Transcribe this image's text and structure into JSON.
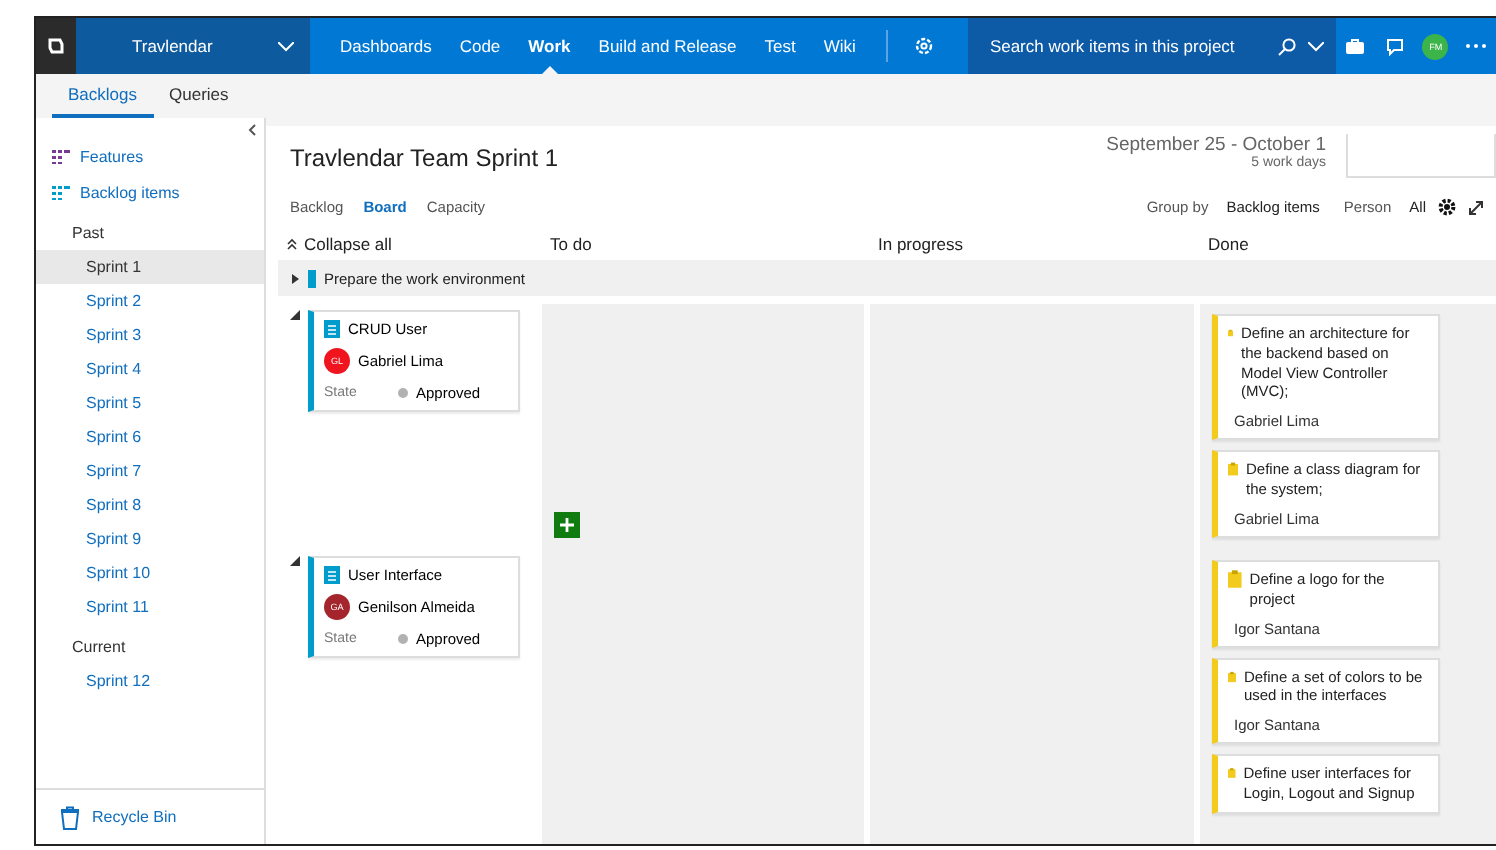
{
  "topbar": {
    "project": "Travlendar",
    "nav": [
      {
        "label": "Dashboards",
        "selected": false
      },
      {
        "label": "Code",
        "selected": false
      },
      {
        "label": "Work",
        "selected": true
      },
      {
        "label": "Build and Release",
        "selected": false
      },
      {
        "label": "Test",
        "selected": false
      },
      {
        "label": "Wiki",
        "selected": false
      }
    ],
    "search": {
      "placeholder": "Search work items in this project"
    },
    "user_initials": "FM"
  },
  "subtabs": [
    {
      "label": "Backlogs",
      "selected": true
    },
    {
      "label": "Queries",
      "selected": false
    }
  ],
  "sidebar": {
    "links": [
      {
        "label": "Features",
        "kind": "features"
      },
      {
        "label": "Backlog items",
        "kind": "backlog"
      }
    ],
    "groups": [
      {
        "label": "Past",
        "sprints": [
          {
            "label": "Sprint 1",
            "selected": true
          },
          {
            "label": "Sprint 2",
            "selected": false
          },
          {
            "label": "Sprint 3",
            "selected": false
          },
          {
            "label": "Sprint 4",
            "selected": false
          },
          {
            "label": "Sprint 5",
            "selected": false
          },
          {
            "label": "Sprint 6",
            "selected": false
          },
          {
            "label": "Sprint 7",
            "selected": false
          },
          {
            "label": "Sprint 8",
            "selected": false
          },
          {
            "label": "Sprint 9",
            "selected": false
          },
          {
            "label": "Sprint 10",
            "selected": false
          },
          {
            "label": "Sprint 11",
            "selected": false
          }
        ]
      },
      {
        "label": "Current",
        "sprints": [
          {
            "label": "Sprint 12",
            "selected": false
          }
        ]
      }
    ],
    "recycle": "Recycle Bin"
  },
  "main": {
    "title": "Travlendar Team Sprint 1",
    "dates": "September 25 - October 1",
    "work_days": "5 work days",
    "views": [
      {
        "label": "Backlog",
        "selected": false
      },
      {
        "label": "Board",
        "selected": true
      },
      {
        "label": "Capacity",
        "selected": false
      }
    ],
    "group_by": {
      "label": "Group by",
      "value": "Backlog items"
    },
    "person": {
      "label": "Person",
      "value": "All"
    },
    "collapse_all": "Collapse all",
    "columns": [
      "To do",
      "In progress",
      "Done"
    ],
    "collapsed_row": {
      "title": "Prepare the work environment",
      "expanded": false
    },
    "lanes": [
      {
        "title": "CRUD User",
        "expanded": true,
        "assignee": "Gabriel Lima",
        "initials": "GL",
        "color": "#f0141e",
        "state_label": "State",
        "state": "Approved",
        "add_button": true,
        "done": [
          {
            "title": "Define an architecture for the backend based on Model View Controller (MVC);",
            "assignee": "Gabriel Lima"
          },
          {
            "title": "Define a class diagram for the system;",
            "assignee": "Gabriel Lima"
          }
        ]
      },
      {
        "title": "User Interface",
        "expanded": true,
        "assignee": "Genilson Almeida",
        "initials": "GA",
        "color": "#a4262c",
        "state_label": "State",
        "state": "Approved",
        "add_button": false,
        "done": [
          {
            "title": "Define a logo for the project",
            "assignee": "Igor Santana"
          },
          {
            "title": "Define a set of colors to be used in the interfaces",
            "assignee": "Igor Santana"
          },
          {
            "title": "Define user interfaces for Login, Logout and Signup"
          }
        ]
      }
    ]
  }
}
